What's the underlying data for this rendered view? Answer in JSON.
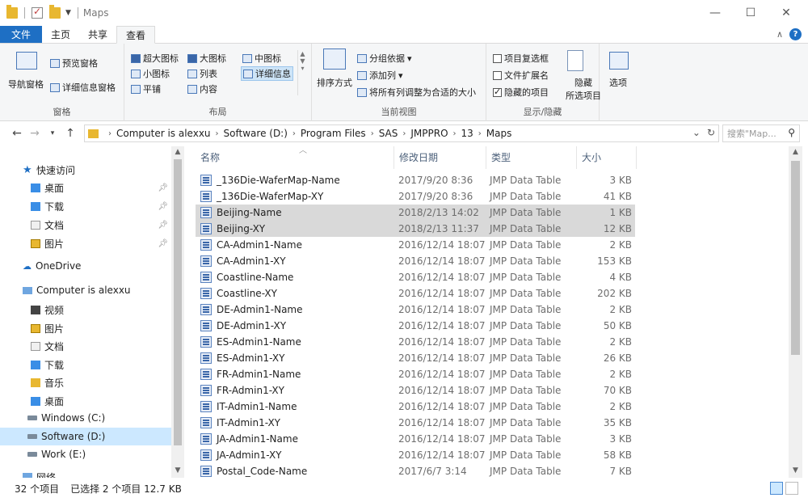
{
  "window": {
    "title": "Maps",
    "minimize": "—",
    "maximize": "☐",
    "close": "✕"
  },
  "ribbon_tabs": {
    "file": "文件",
    "home": "主页",
    "share": "共享",
    "view": "查看"
  },
  "ribbon": {
    "panes": {
      "nav_pane": "导航窗格",
      "preview_pane": "预览窗格",
      "details_pane": "详细信息窗格",
      "label": "窗格"
    },
    "layout": {
      "extra_large": "超大图标",
      "large": "大图标",
      "medium": "中图标",
      "small": "小图标",
      "list": "列表",
      "details": "详细信息",
      "tiles": "平铺",
      "content": "内容",
      "label": "布局"
    },
    "current_view": {
      "sort_by": "排序方式",
      "group_by": "分组依据",
      "add_columns": "添加列",
      "size_all_columns": "将所有列调整为合适的大小",
      "label": "当前视图"
    },
    "show_hide": {
      "item_checkboxes": "项目复选框",
      "file_extensions": "文件扩展名",
      "hidden_items": "隐藏的项目",
      "hide_selected_line1": "隐藏",
      "hide_selected_line2": "所选项目",
      "label": "显示/隐藏"
    },
    "options": "选项"
  },
  "address": {
    "breadcrumbs": [
      "Computer is alexxu",
      "Software (D:)",
      "Program Files",
      "SAS",
      "JMPPRO",
      "13",
      "Maps"
    ],
    "search_placeholder": "搜索\"Map..."
  },
  "nav": {
    "quick_access": "快速访问",
    "qa_desktop": "桌面",
    "qa_downloads": "下载",
    "qa_documents": "文档",
    "qa_pictures": "图片",
    "onedrive": "OneDrive",
    "computer": "Computer is alexxu",
    "videos": "视频",
    "pictures": "图片",
    "documents": "文档",
    "downloads": "下载",
    "music": "音乐",
    "desktop": "桌面",
    "drive_c": "Windows (C:)",
    "drive_d": "Software (D:)",
    "drive_e": "Work (E:)",
    "network": "网络"
  },
  "columns": {
    "name": "名称",
    "date": "修改日期",
    "type": "类型",
    "size": "大小"
  },
  "files": [
    {
      "name": "_136Die-WaferMap-Name",
      "date": "2017/9/20 8:36",
      "type": "JMP Data Table",
      "size": "3 KB"
    },
    {
      "name": "_136Die-WaferMap-XY",
      "date": "2017/9/20 8:36",
      "type": "JMP Data Table",
      "size": "41 KB"
    },
    {
      "name": "Beijing-Name",
      "date": "2018/2/13 14:02",
      "type": "JMP Data Table",
      "size": "1 KB"
    },
    {
      "name": "Beijing-XY",
      "date": "2018/2/13 11:37",
      "type": "JMP Data Table",
      "size": "12 KB"
    },
    {
      "name": "CA-Admin1-Name",
      "date": "2016/12/14 18:07",
      "type": "JMP Data Table",
      "size": "2 KB"
    },
    {
      "name": "CA-Admin1-XY",
      "date": "2016/12/14 18:07",
      "type": "JMP Data Table",
      "size": "153 KB"
    },
    {
      "name": "Coastline-Name",
      "date": "2016/12/14 18:07",
      "type": "JMP Data Table",
      "size": "4 KB"
    },
    {
      "name": "Coastline-XY",
      "date": "2016/12/14 18:07",
      "type": "JMP Data Table",
      "size": "202 KB"
    },
    {
      "name": "DE-Admin1-Name",
      "date": "2016/12/14 18:07",
      "type": "JMP Data Table",
      "size": "2 KB"
    },
    {
      "name": "DE-Admin1-XY",
      "date": "2016/12/14 18:07",
      "type": "JMP Data Table",
      "size": "50 KB"
    },
    {
      "name": "ES-Admin1-Name",
      "date": "2016/12/14 18:07",
      "type": "JMP Data Table",
      "size": "2 KB"
    },
    {
      "name": "ES-Admin1-XY",
      "date": "2016/12/14 18:07",
      "type": "JMP Data Table",
      "size": "26 KB"
    },
    {
      "name": "FR-Admin1-Name",
      "date": "2016/12/14 18:07",
      "type": "JMP Data Table",
      "size": "2 KB"
    },
    {
      "name": "FR-Admin1-XY",
      "date": "2016/12/14 18:07",
      "type": "JMP Data Table",
      "size": "70 KB"
    },
    {
      "name": "IT-Admin1-Name",
      "date": "2016/12/14 18:07",
      "type": "JMP Data Table",
      "size": "2 KB"
    },
    {
      "name": "IT-Admin1-XY",
      "date": "2016/12/14 18:07",
      "type": "JMP Data Table",
      "size": "35 KB"
    },
    {
      "name": "JA-Admin1-Name",
      "date": "2016/12/14 18:07",
      "type": "JMP Data Table",
      "size": "3 KB"
    },
    {
      "name": "JA-Admin1-XY",
      "date": "2016/12/14 18:07",
      "type": "JMP Data Table",
      "size": "58 KB"
    },
    {
      "name": "Postal_Code-Name",
      "date": "2017/6/7 3:14",
      "type": "JMP Data Table",
      "size": "7 KB"
    }
  ],
  "selected_files": [
    "Beijing-Name",
    "Beijing-XY"
  ],
  "status": {
    "item_count": "32 个项目",
    "selection": "已选择 2 个项目 12.7 KB"
  }
}
